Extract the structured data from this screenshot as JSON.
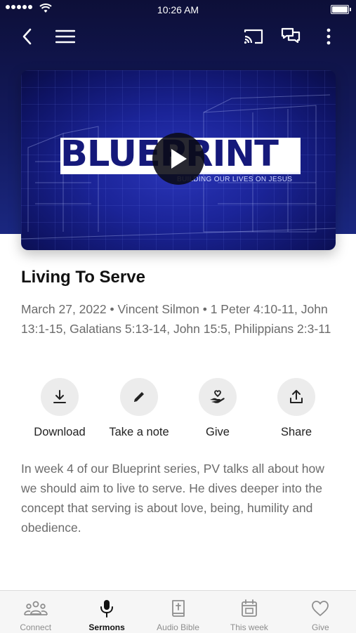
{
  "status_bar": {
    "time": "10:26 AM",
    "battery_level": 1.0
  },
  "header": {
    "back_icon": "chevron-left-icon",
    "menu_icon": "hamburger-menu-icon",
    "cast_icon": "cast-icon",
    "chat_icon": "chat-bubbles-icon",
    "more_icon": "more-vertical-icon"
  },
  "media": {
    "artwork_title_dark": "BLUEP",
    "artwork_title_light": "RINT",
    "artwork_subtitle": "BUILDING OUR LIVES ON JESUS",
    "play_icon": "play-icon"
  },
  "sermon": {
    "title": "Living To Serve",
    "meta": "March 27, 2022 • Vincent Silmon • 1 Peter 4:10-11, John 13:1-15, Galatians 5:13-14, John 15:5, Philippians 2:3-11",
    "description": "In week 4 of our Blueprint series, PV talks all about how we should aim to live to serve. He dives deeper into the concept that serving is about love, being, humility and obedience."
  },
  "actions": [
    {
      "label": "Download",
      "icon": "download-icon"
    },
    {
      "label": "Take a note",
      "icon": "pencil-icon"
    },
    {
      "label": "Give",
      "icon": "heart-hand-icon"
    },
    {
      "label": "Share",
      "icon": "share-icon"
    }
  ],
  "tabs": [
    {
      "label": "Connect",
      "icon": "people-icon",
      "active": false
    },
    {
      "label": "Sermons",
      "icon": "microphone-icon",
      "active": true
    },
    {
      "label": "Audio Bible",
      "icon": "bible-icon",
      "active": false
    },
    {
      "label": "This week",
      "icon": "calendar-icon",
      "active": false
    },
    {
      "label": "Give",
      "icon": "heart-icon",
      "active": false
    }
  ],
  "colors": {
    "header_bg": "#131a5e",
    "accent_dark": "#111111",
    "muted_text": "#6b6b6b",
    "inactive_tab": "#8e8e8e",
    "action_circle": "#ececec"
  }
}
